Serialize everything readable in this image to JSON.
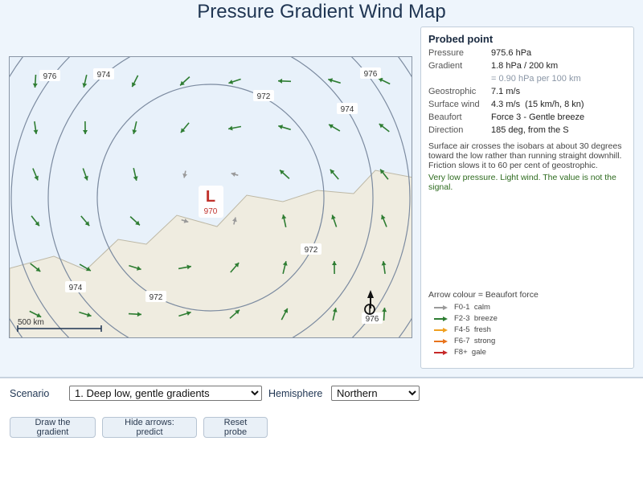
{
  "title": "Pressure Gradient Wind Map",
  "map": {
    "low_symbol": "L",
    "low_value": "970",
    "isobar_labels": [
      "976",
      "974",
      "972",
      "974",
      "976",
      "972",
      "974",
      "972",
      "976"
    ],
    "scale_label": "500 km",
    "colors": {
      "isobar": "#7c8ba0",
      "land": "#efece0",
      "sea": "#e8f1fa",
      "low": "#c0302b"
    }
  },
  "probe": {
    "title": "Probed point",
    "rows": [
      {
        "key": "Pressure",
        "value": "975.6 hPa"
      },
      {
        "key": "Gradient",
        "value": "1.8 hPa / 200 km"
      },
      {
        "key": "",
        "value": "= 0.90 hPa per 100 km"
      },
      {
        "key": "Geostrophic",
        "value": "7.1 m/s"
      },
      {
        "key": "Surface wind",
        "value": "4.3 m/s  (15 km/h, 8 kn)"
      },
      {
        "key": "Beaufort",
        "value": "Force 3 - Gentle breeze"
      },
      {
        "key": "Direction",
        "value": "185 deg, from the S"
      }
    ],
    "explanation": "Surface air crosses the isobars at about 30 degrees toward the low rather than running straight downhill. Friction slows it to 60 per cent of geostrophic.",
    "note": "Very low pressure. Light wind. The value is not the signal."
  },
  "legend": {
    "title": "Arrow colour = Beaufort force",
    "items": [
      {
        "code": "F0-1",
        "name": "calm",
        "color": "#9a9a9a"
      },
      {
        "code": "F2-3",
        "name": "breeze",
        "color": "#2e7d32"
      },
      {
        "code": "F4-5",
        "name": "fresh",
        "color": "#f0a020"
      },
      {
        "code": "F6-7",
        "name": "strong",
        "color": "#e8731c"
      },
      {
        "code": "F8+",
        "name": "gale",
        "color": "#c62828"
      }
    ]
  },
  "controls": {
    "scenario_label": "Scenario",
    "scenario_value": "1. Deep low, gentle gradients",
    "hemisphere_label": "Hemisphere",
    "hemisphere_value": "Northern",
    "buttons": [
      "Draw the gradient",
      "Hide arrows: predict",
      "Reset probe"
    ]
  }
}
